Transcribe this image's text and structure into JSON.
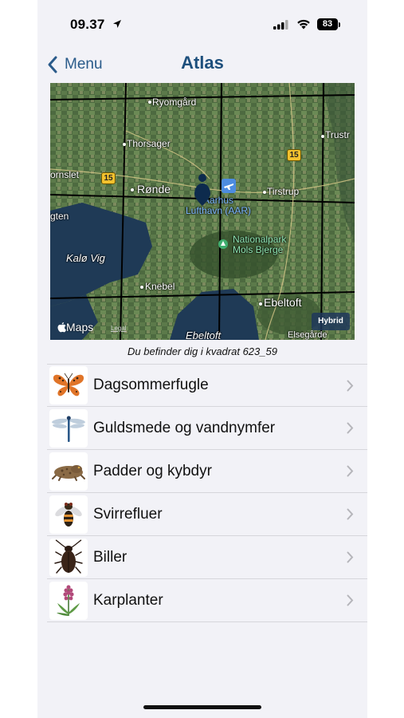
{
  "status_bar": {
    "time": "09.37",
    "battery": "83",
    "icons": [
      "location-arrow-icon",
      "cellular-signal-icon",
      "wifi-icon",
      "battery-icon"
    ]
  },
  "nav": {
    "back_label": "Menu",
    "title": "Atlas"
  },
  "map": {
    "places": {
      "ryomgaard": "Ryomgård",
      "thorsager": "Thorsager",
      "trustrup": "Trustr",
      "hornslet": "ornslet",
      "ronde": "Rønde",
      "tirstrup": "Tirstrup",
      "aarhus_airport_line1": "Aarhus",
      "aarhus_airport_line2": "Lufthavn (AAR)",
      "ugten": "gten",
      "kalo_vig": "Kalø Vig",
      "national_park_line1": "Nationalpark",
      "national_park_line2": "Mols Bjerge",
      "knebel": "Knebel",
      "ebeltoft": "Ebeltoft",
      "ebeltoft_bay": "Ebeltoft",
      "elsegaarde": "Elsegårde"
    },
    "road_badges": [
      "15",
      "15",
      "15"
    ],
    "logo_text": "Maps",
    "legal_text": "Legal",
    "hybrid_button": "Hybrid"
  },
  "caption": "Du befinder dig i kvadrat 623_59",
  "list": [
    {
      "label": "Dagsommerfugle",
      "icon": "butterfly-icon"
    },
    {
      "label": "Guldsmede og vandnymfer",
      "icon": "dragonfly-icon"
    },
    {
      "label": "Padder og kybdyr",
      "icon": "toad-icon"
    },
    {
      "label": "Svirrefluer",
      "icon": "hoverfly-icon"
    },
    {
      "label": "Biller",
      "icon": "beetle-icon"
    },
    {
      "label": "Karplanter",
      "icon": "orchid-icon"
    }
  ],
  "colors": {
    "accent": "#2a5b8a",
    "title": "#1d4f7c",
    "background": "#f2f2f7"
  }
}
